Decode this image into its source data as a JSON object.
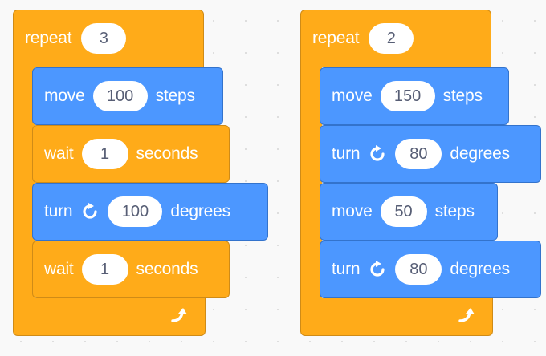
{
  "scripts": [
    {
      "repeat_label": "repeat",
      "repeat_count": "3",
      "blocks": [
        {
          "type": "motion",
          "parts": [
            "move",
            "100",
            "steps"
          ]
        },
        {
          "type": "control",
          "parts": [
            "wait",
            "1",
            "seconds"
          ]
        },
        {
          "type": "motion",
          "parts": [
            "turn",
            "100",
            "degrees"
          ],
          "icon": "rotate-clockwise-icon"
        },
        {
          "type": "control",
          "parts": [
            "wait",
            "1",
            "seconds"
          ]
        }
      ],
      "loop_icon": "loop-arrow-icon"
    },
    {
      "repeat_label": "repeat",
      "repeat_count": "2",
      "blocks": [
        {
          "type": "motion",
          "parts": [
            "move",
            "150",
            "steps"
          ]
        },
        {
          "type": "motion",
          "parts": [
            "turn",
            "80",
            "degrees"
          ],
          "icon": "rotate-clockwise-icon"
        },
        {
          "type": "motion",
          "parts": [
            "move",
            "50",
            "steps"
          ]
        },
        {
          "type": "motion",
          "parts": [
            "turn",
            "80",
            "degrees"
          ],
          "icon": "rotate-clockwise-icon"
        }
      ],
      "loop_icon": "loop-arrow-icon"
    }
  ],
  "colors": {
    "motion": "#4c97ff",
    "control": "#ffab19",
    "text": "#ffffff",
    "input_text": "#575e75"
  }
}
